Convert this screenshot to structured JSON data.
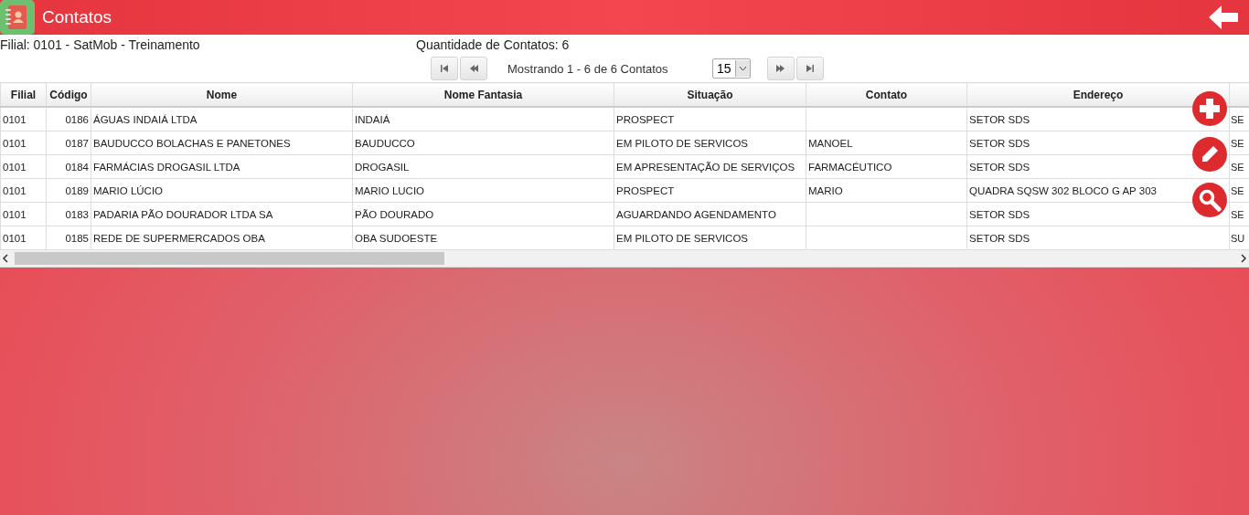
{
  "header": {
    "title": "Contatos"
  },
  "info": {
    "filial": "Filial: 0101 - SatMob - Treinamento",
    "quantidade": "Quantidade de Contatos: 6"
  },
  "pager": {
    "summary": "Mostrando 1 - 6 de 6 Contatos",
    "page_size": "15"
  },
  "table": {
    "columns": [
      "Filial",
      "Código",
      "Nome",
      "Nome Fantasia",
      "Situação",
      "Contato",
      "Endereço",
      ""
    ],
    "rows": [
      [
        "0101",
        "0186",
        "ÁGUAS INDAIÁ LTDA",
        "INDAIÁ",
        "PROSPECT",
        "",
        "SETOR SDS",
        "SE"
      ],
      [
        "0101",
        "0187",
        "BAUDUCCO BOLACHAS E PANETONES",
        "BAUDUCCO",
        "EM PILOTO DE SERVICOS",
        "MANOEL",
        "SETOR SDS",
        "SE"
      ],
      [
        "0101",
        "0184",
        "FARMÁCIAS DROGASIL LTDA",
        "DROGASIL",
        "EM APRESENTAÇÃO DE SERVIÇOS",
        "FARMACÉUTICO",
        "SETOR SDS",
        "SE"
      ],
      [
        "0101",
        "0189",
        "MARIO LÚCIO",
        "MARIO LUCIO",
        "PROSPECT",
        "MARIO",
        "QUADRA SQSW 302 BLOCO G AP 303",
        "SE"
      ],
      [
        "0101",
        "0183",
        "PADARIA PÃO DOURADOR LTDA SA",
        "PÃO DOURADO",
        "AGUARDANDO AGENDAMENTO",
        "",
        "SETOR SDS",
        "SE"
      ],
      [
        "0101",
        "0185",
        "REDE DE SUPERMERCADOS OBA",
        "OBA SUDOESTE",
        "EM PILOTO DE SERVICOS",
        "",
        "SETOR SDS",
        "SU"
      ]
    ]
  }
}
